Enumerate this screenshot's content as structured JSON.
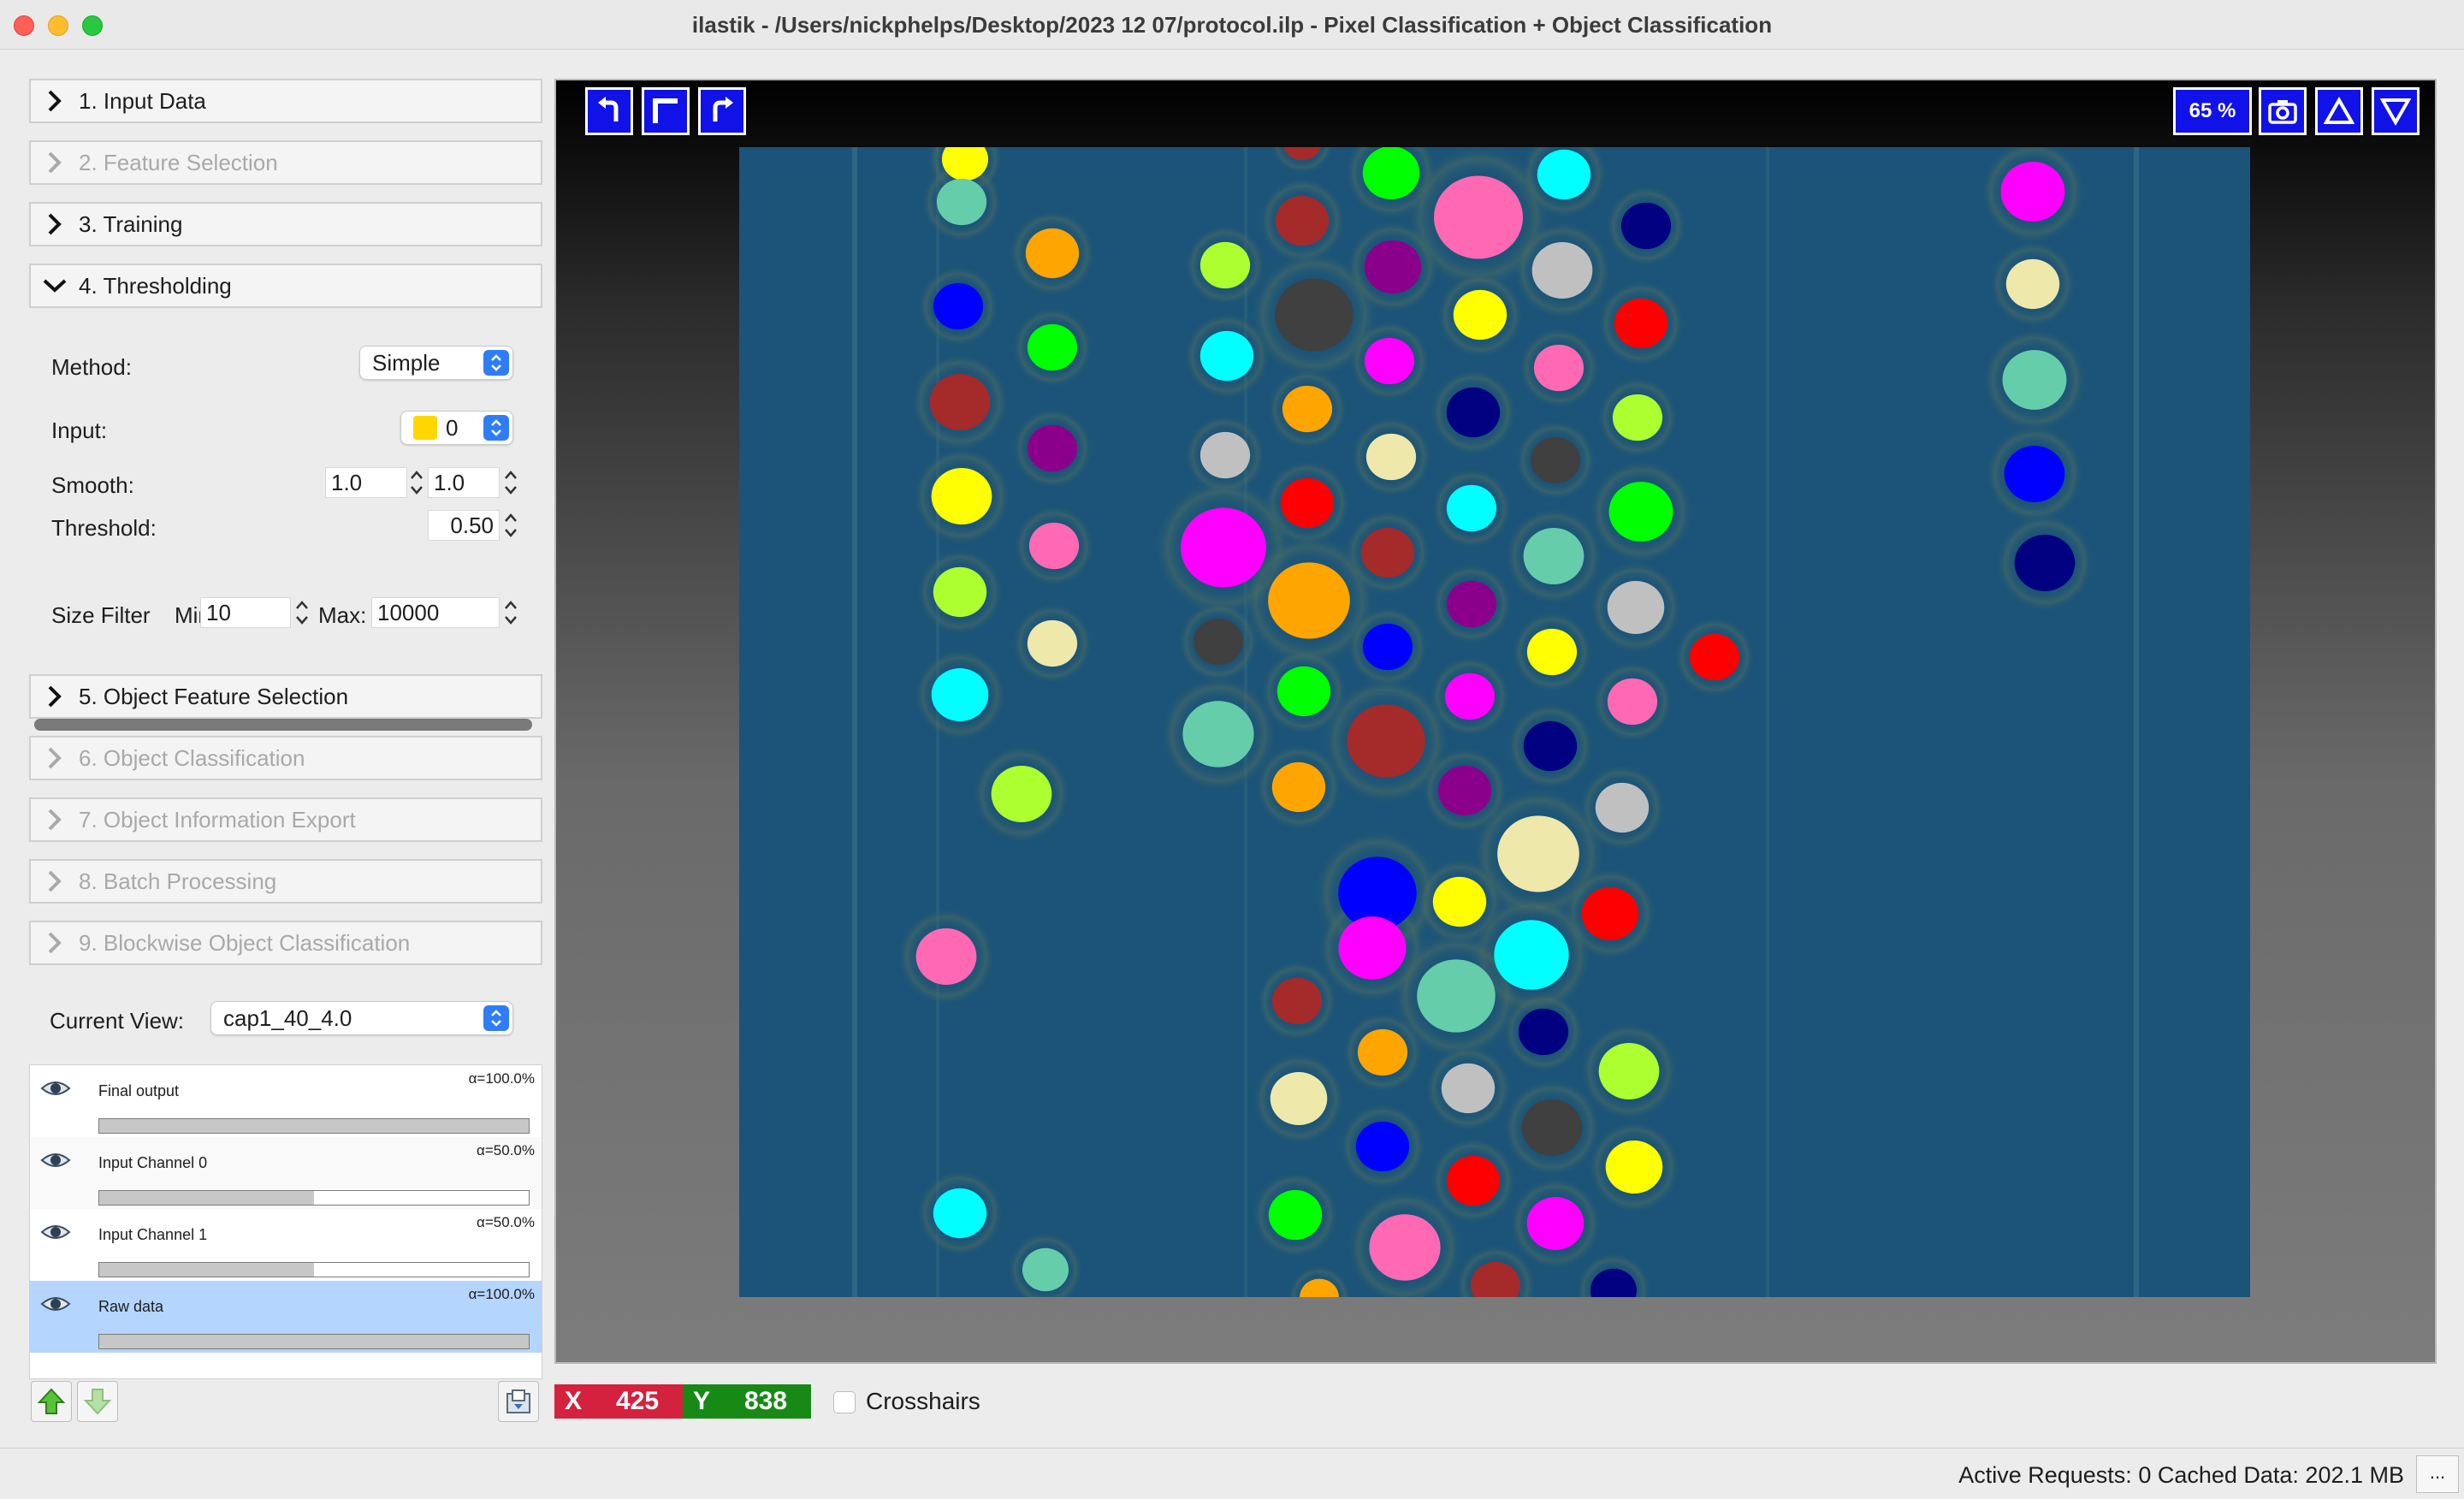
{
  "window": {
    "title": "ilastik - /Users/nickphelps/Desktop/2023 12 07/protocol.ilp - Pixel Classification + Object Classification"
  },
  "applets": [
    {
      "label": "1. Input Data",
      "enabled": true,
      "expanded": false
    },
    {
      "label": "2. Feature Selection",
      "enabled": false,
      "expanded": false
    },
    {
      "label": "3. Training",
      "enabled": true,
      "expanded": false
    },
    {
      "label": "4. Thresholding",
      "enabled": true,
      "expanded": true
    },
    {
      "label": "5. Object Feature Selection",
      "enabled": true,
      "expanded": false
    },
    {
      "label": "6. Object Classification",
      "enabled": false,
      "expanded": false
    },
    {
      "label": "7. Object Information Export",
      "enabled": false,
      "expanded": false
    },
    {
      "label": "8. Batch Processing",
      "enabled": false,
      "expanded": false
    },
    {
      "label": "9. Blockwise Object Classification",
      "enabled": false,
      "expanded": false
    }
  ],
  "thresholding": {
    "method_label": "Method:",
    "method_value": "Simple",
    "input_label": "Input:",
    "input_value": "0",
    "input_swatch_color": "#ffd700",
    "smooth_label": "Smooth:",
    "smooth_x": "1.0",
    "smooth_y": "1.0",
    "threshold_label": "Threshold:",
    "threshold_value": "0.50",
    "size_filter_label": "Size Filter",
    "min_label": "Min:",
    "min_value": "10",
    "max_label": "Max:",
    "max_value": "10000"
  },
  "current_view": {
    "label": "Current View:",
    "value": "cap1_40_4.0"
  },
  "layers": [
    {
      "name": "Final output",
      "alpha": "α=100.0%",
      "opacity": 1.0,
      "selected": false
    },
    {
      "name": "Input Channel 0",
      "alpha": "α=50.0%",
      "opacity": 0.5,
      "selected": false
    },
    {
      "name": "Input Channel 1",
      "alpha": "α=50.0%",
      "opacity": 0.5,
      "selected": false
    },
    {
      "name": "Raw data",
      "alpha": "α=100.0%",
      "opacity": 1.0,
      "selected": true
    }
  ],
  "viewer": {
    "zoom": "65 %",
    "toolbar_icons": [
      "rotate-left-icon",
      "fit-view-icon",
      "rotate-right-icon"
    ],
    "right_icons": [
      "camera-icon",
      "triangle-up-icon",
      "triangle-down-icon"
    ],
    "background_color": "#1b5478",
    "accent_button_color": "#1012e8"
  },
  "coords": {
    "x_key": "X",
    "x_value": "425",
    "y_key": "Y",
    "y_value": "838",
    "x_color": "#d4213e",
    "y_color": "#178a16"
  },
  "crosshairs": {
    "label": "Crosshairs",
    "checked": false
  },
  "status": {
    "text": "Active Requests: 0  Cached Data: 202.1 MB",
    "more": "..."
  }
}
